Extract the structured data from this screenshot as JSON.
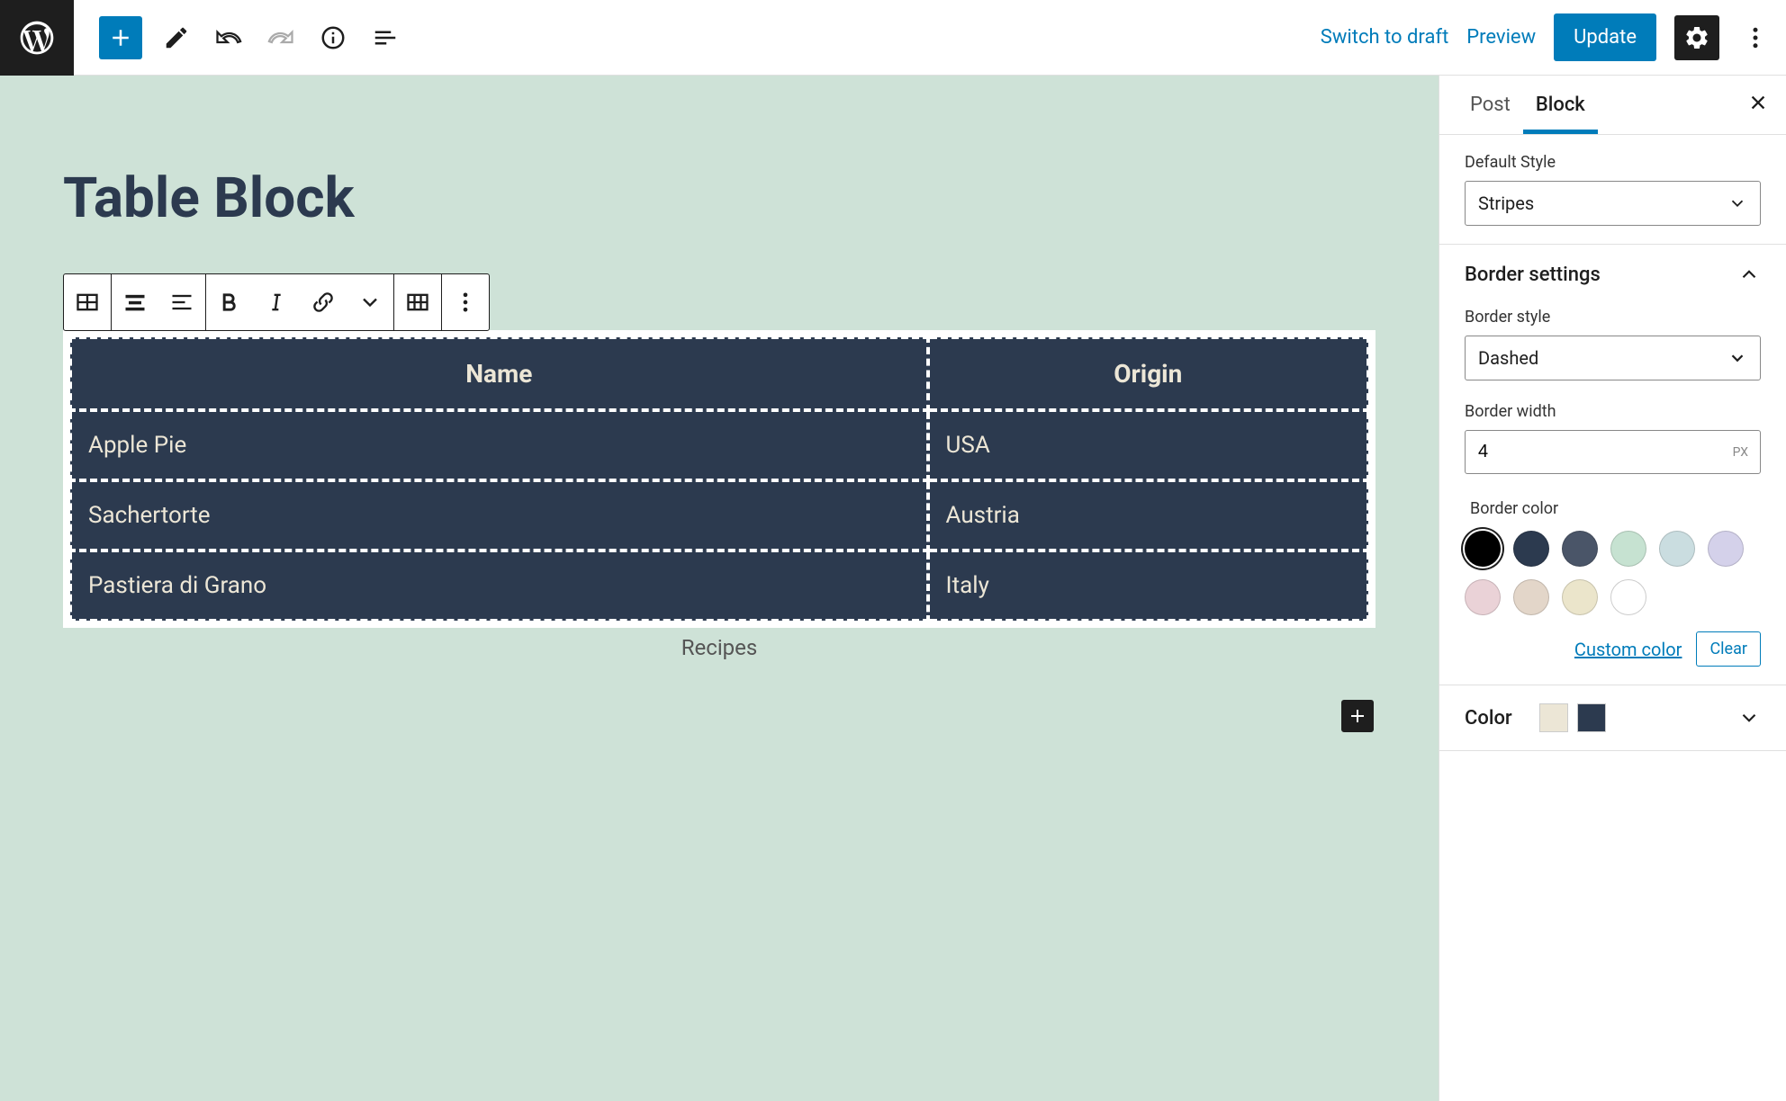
{
  "topbar": {
    "switch_draft": "Switch to draft",
    "preview": "Preview",
    "update": "Update"
  },
  "page": {
    "title": "Table Block"
  },
  "table": {
    "headers": [
      "Name",
      "Origin"
    ],
    "rows": [
      [
        "Apple Pie",
        "USA"
      ],
      [
        "Sachertorte",
        "Austria"
      ],
      [
        "Pastiera di Grano",
        "Italy"
      ]
    ],
    "caption": "Recipes"
  },
  "sidebar": {
    "tabs": {
      "post": "Post",
      "block": "Block"
    },
    "default_style": {
      "label": "Default Style",
      "value": "Stripes"
    },
    "border_settings": {
      "title": "Border settings",
      "style": {
        "label": "Border style",
        "value": "Dashed"
      },
      "width": {
        "label": "Border width",
        "value": "4",
        "unit": "PX"
      },
      "color": {
        "label": "Border color",
        "swatches": [
          "#000000",
          "#2c3a4f",
          "#4a5568",
          "#c6e2d1",
          "#cadde0",
          "#d4d1ea",
          "#ead2d7",
          "#e3d6c9",
          "#ebe5cb",
          "#ffffff"
        ],
        "selected": 0,
        "custom": "Custom color",
        "clear": "Clear"
      }
    },
    "color": {
      "title": "Color",
      "swatches": [
        "#ece6d6",
        "#2c3a4f"
      ]
    }
  }
}
